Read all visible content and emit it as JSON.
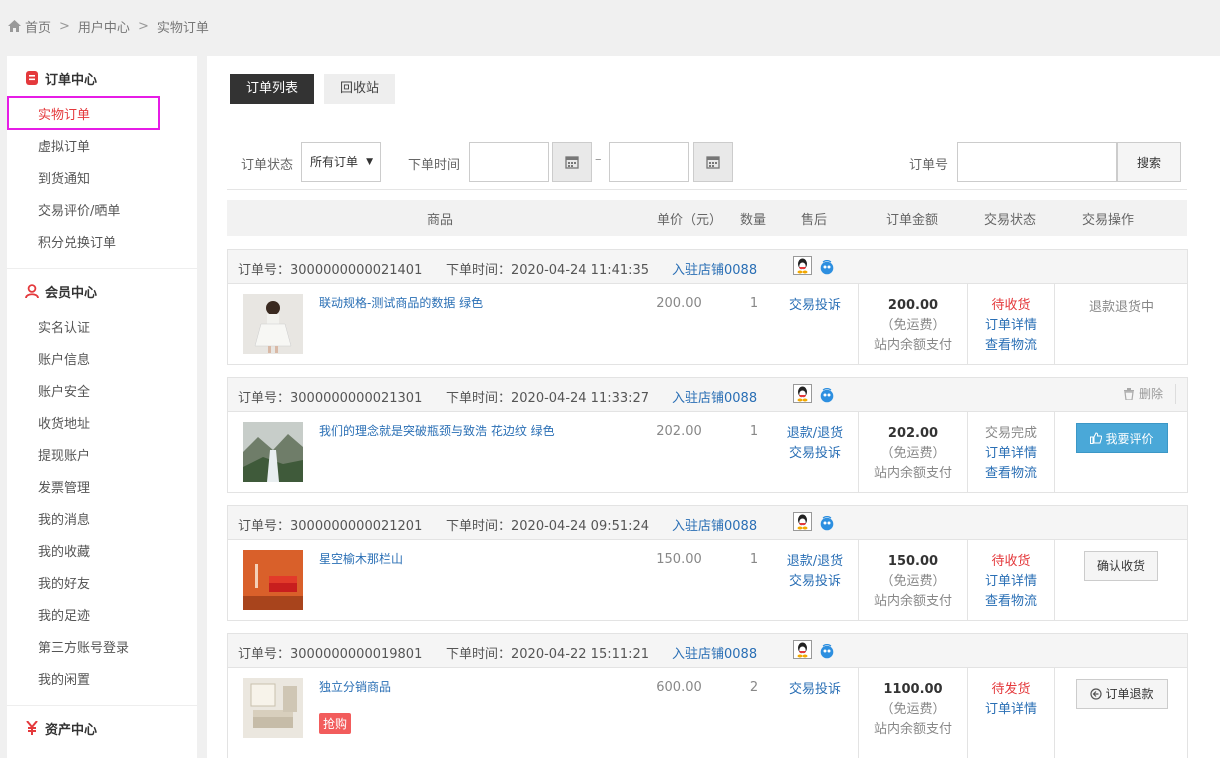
{
  "breadcrumb": {
    "home": "首页",
    "sep": ">",
    "user_center": "用户中心",
    "current": "实物订单"
  },
  "sidebar": {
    "order_center": {
      "title": "订单中心",
      "items": [
        "实物订单",
        "虚拟订单",
        "到货通知",
        "交易评价/晒单",
        "积分兑换订单"
      ]
    },
    "member_center": {
      "title": "会员中心",
      "items": [
        "实名认证",
        "账户信息",
        "账户安全",
        "收货地址",
        "提现账户",
        "发票管理",
        "我的消息",
        "我的收藏",
        "我的好友",
        "我的足迹",
        "第三方账号登录",
        "我的闲置"
      ]
    },
    "asset_center": {
      "title": "资产中心"
    }
  },
  "tabs": [
    "订单列表",
    "回收站"
  ],
  "filter": {
    "status_label": "订单状态",
    "status_value": "所有订单",
    "time_label": "下单时间",
    "dash": "–",
    "order_label": "订单号",
    "search_btn": "搜索"
  },
  "table_head": {
    "goods": "商品",
    "price": "单价（元）",
    "qty": "数量",
    "after": "售后",
    "amount": "订单金额",
    "status": "交易状态",
    "ops": "交易操作"
  },
  "orders": [
    {
      "num": "订单号：3000000000021401",
      "time": "下单时间：2020-04-24 11:41:35",
      "shop": "入驻店铺0088",
      "name": "联动规格-测试商品的数据 绿色",
      "price": "200.00",
      "qty": "1",
      "after1": "交易投诉",
      "after2": "",
      "amount": "200.00",
      "ship": "（免运费）",
      "pay": "站内余额支付",
      "status": "待收货",
      "status2": "订单详情",
      "status3": "查看物流",
      "op": "退款退货中"
    },
    {
      "num": "订单号：3000000000021301",
      "time": "下单时间：2020-04-24 11:33:27",
      "shop": "入驻店铺0088",
      "name": "我们的理念就是突破瓶颈与致浩 花边纹 绿色",
      "price": "202.00",
      "qty": "1",
      "after1": "退款/退货",
      "after2": "交易投诉",
      "amount": "202.00",
      "ship": "（免运费）",
      "pay": "站内余额支付",
      "status": "交易完成",
      "status2": "订单详情",
      "status3": "查看物流",
      "op": "我要评价",
      "delete": "删除"
    },
    {
      "num": "订单号：3000000000021201",
      "time": "下单时间：2020-04-24 09:51:24",
      "shop": "入驻店铺0088",
      "name": "星空榆木那栏山",
      "price": "150.00",
      "qty": "1",
      "after1": "退款/退货",
      "after2": "交易投诉",
      "amount": "150.00",
      "ship": "（免运费）",
      "pay": "站内余额支付",
      "status": "待收货",
      "status2": "订单详情",
      "status3": "查看物流",
      "op": "确认收货"
    },
    {
      "num": "订单号：3000000000019801",
      "time": "下单时间：2020-04-22 15:11:21",
      "shop": "入驻店铺0088",
      "name": "独立分销商品",
      "tag": "抢购",
      "price": "600.00",
      "qty": "2",
      "after1": "交易投诉",
      "after2": "",
      "amount": "1100.00",
      "ship": "（免运费）",
      "pay": "站内余额支付",
      "status": "待发货",
      "status2": "订单详情",
      "status3": "",
      "op": "订单退款"
    }
  ]
}
